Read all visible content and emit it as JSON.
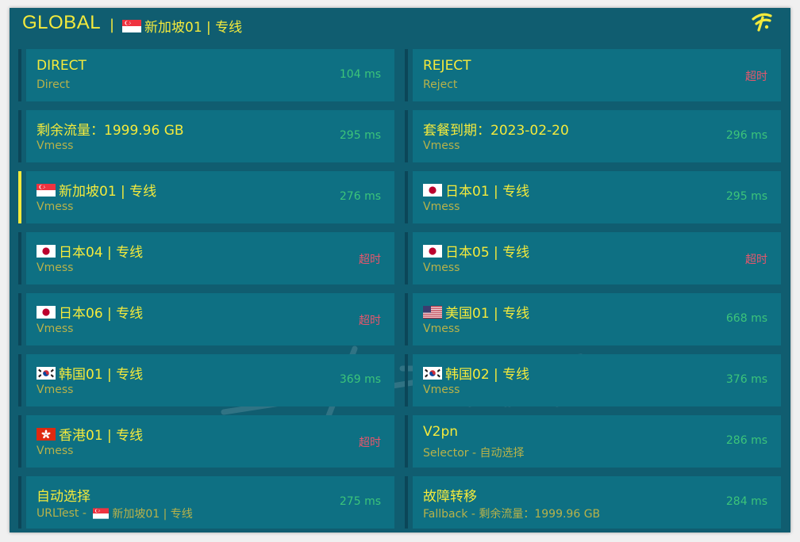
{
  "header": {
    "mode": "GLOBAL",
    "separator": "|",
    "current_proxy": "新加坡01 | 专线",
    "current_flag": "sg"
  },
  "colors": {
    "panel_bg": "#105d70",
    "card_bg": "#0e7083",
    "accent_yellow": "#f4ea3c",
    "latency_ok": "#3cc47a",
    "latency_timeout": "#e8566c"
  },
  "proxies": [
    {
      "name": "DIRECT",
      "flag": "",
      "type": "Direct",
      "delay": "104 ms",
      "status": "ok",
      "active": false
    },
    {
      "name": "REJECT",
      "flag": "",
      "type": "Reject",
      "delay": "超时",
      "status": "timeout",
      "active": false
    },
    {
      "name": "剩余流量：1999.96 GB",
      "flag": "",
      "type": "Vmess",
      "delay": "295 ms",
      "status": "ok",
      "active": false
    },
    {
      "name": "套餐到期：2023-02-20",
      "flag": "",
      "type": "Vmess",
      "delay": "296 ms",
      "status": "ok",
      "active": false
    },
    {
      "name": "新加坡01 | 专线",
      "flag": "sg",
      "type": "Vmess",
      "delay": "276 ms",
      "status": "ok",
      "active": true
    },
    {
      "name": "日本01 | 专线",
      "flag": "jp",
      "type": "Vmess",
      "delay": "295 ms",
      "status": "ok",
      "active": false
    },
    {
      "name": "日本04 | 专线",
      "flag": "jp",
      "type": "Vmess",
      "delay": "超时",
      "status": "timeout",
      "active": false
    },
    {
      "name": "日本05 | 专线",
      "flag": "jp",
      "type": "Vmess",
      "delay": "超时",
      "status": "timeout",
      "active": false
    },
    {
      "name": "日本06 | 专线",
      "flag": "jp",
      "type": "Vmess",
      "delay": "超时",
      "status": "timeout",
      "active": false
    },
    {
      "name": "美国01 | 专线",
      "flag": "us",
      "type": "Vmess",
      "delay": "668 ms",
      "status": "ok",
      "active": false
    },
    {
      "name": "韩国01 | 专线",
      "flag": "kr",
      "type": "Vmess",
      "delay": "369 ms",
      "status": "ok",
      "active": false
    },
    {
      "name": "韩国02 | 专线",
      "flag": "kr",
      "type": "Vmess",
      "delay": "376 ms",
      "status": "ok",
      "active": false
    },
    {
      "name": "香港01 | 专线",
      "flag": "hk",
      "type": "Vmess",
      "delay": "超时",
      "status": "timeout",
      "active": false
    },
    {
      "name": "V2pn",
      "flag": "",
      "type": "Selector - 自动选择",
      "delay": "286 ms",
      "status": "ok",
      "active": false
    },
    {
      "name": "自动选择",
      "flag": "",
      "type": "URLTest - ",
      "sub_flag": "sg",
      "sub_extra": "新加坡01 | 专线",
      "delay": "275 ms",
      "status": "ok",
      "active": false
    },
    {
      "name": "故障转移",
      "flag": "",
      "type": "Fallback - 剩余流量：1999.96 GB",
      "delay": "284 ms",
      "status": "ok",
      "active": false
    }
  ]
}
